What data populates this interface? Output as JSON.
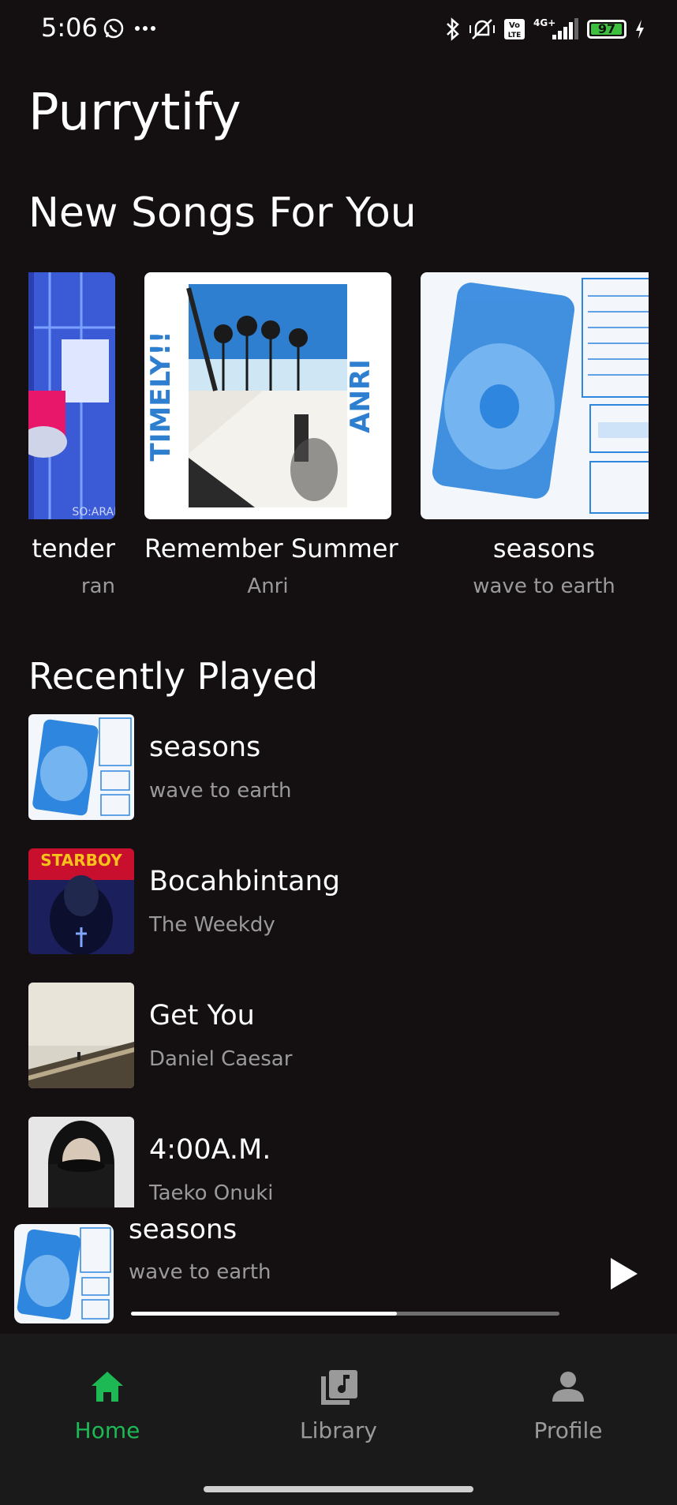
{
  "status_bar": {
    "time": "5:06",
    "battery": "97",
    "network": "4G+"
  },
  "app": {
    "title": "Purrytify"
  },
  "new_songs": {
    "title": "New Songs For You",
    "cards": [
      {
        "title": "tender",
        "artist": "ran",
        "cover_text": "SO:ARAN"
      },
      {
        "title": "Remember Summer",
        "artist": "Anri",
        "cover_text_left": "TIMELY!!",
        "cover_text_right": "ANRI"
      },
      {
        "title": "seasons",
        "artist": "wave to earth"
      }
    ]
  },
  "recently_played": {
    "title": "Recently Played",
    "items": [
      {
        "title": "seasons",
        "artist": "wave to earth"
      },
      {
        "title": "Bocahbintang",
        "artist": "The Weekdy",
        "cover_text": "STARBOY"
      },
      {
        "title": "Get You",
        "artist": "Daniel Caesar"
      },
      {
        "title": "4:00A.M.",
        "artist": "Taeko Onuki"
      }
    ]
  },
  "now_playing": {
    "title": "seasons",
    "artist": "wave to earth",
    "progress": 0.62
  },
  "nav": {
    "home": "Home",
    "library": "Library",
    "profile": "Profile"
  },
  "colors": {
    "accent": "#1db954",
    "background": "#141011",
    "muted": "#9a9a9a",
    "nav_bg": "#1a1a1a"
  }
}
